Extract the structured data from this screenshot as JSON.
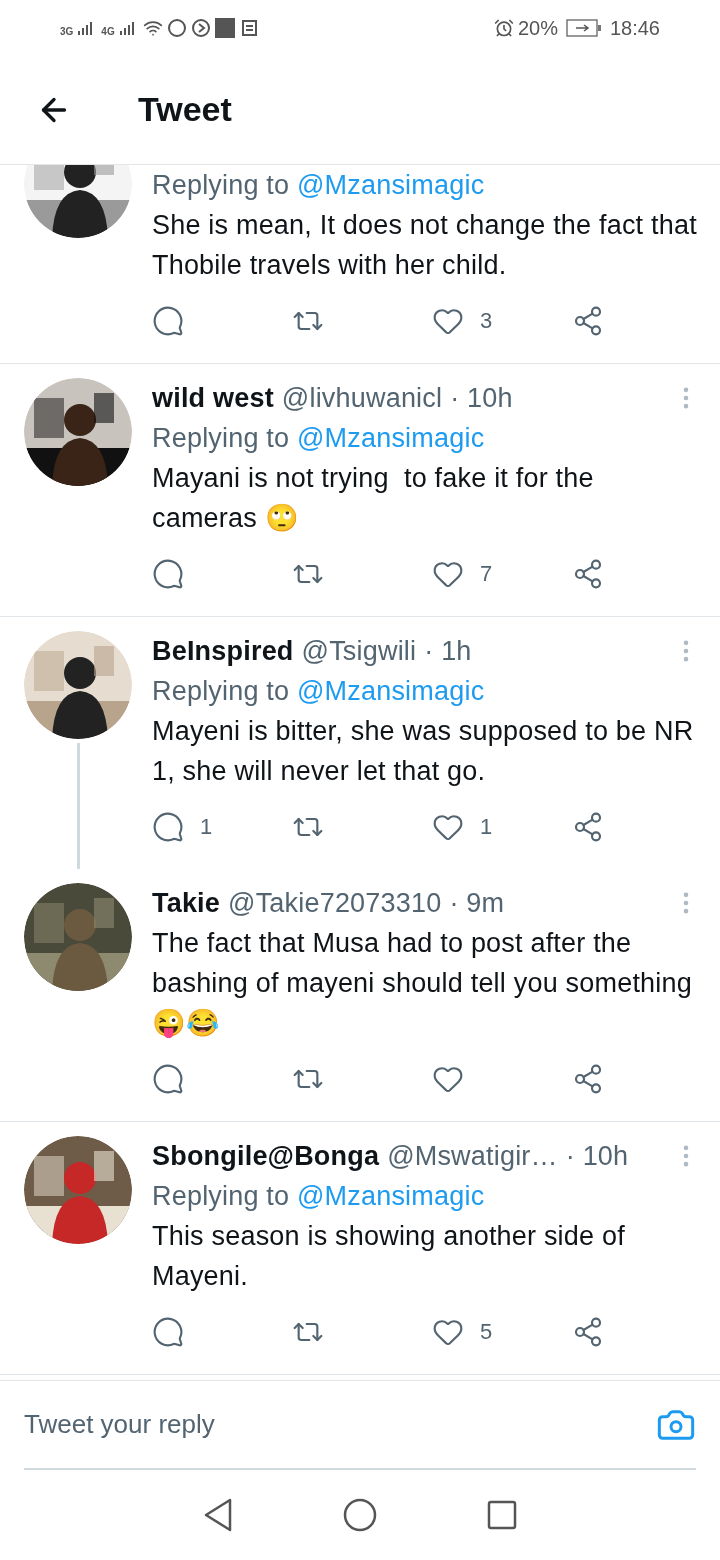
{
  "status_bar": {
    "network_1": "3G",
    "network_2": "4G",
    "battery": "20%",
    "time": "18:46"
  },
  "header": {
    "title": "Tweet"
  },
  "tweets": [
    {
      "replying_prefix": "Replying to",
      "replying_to": "@Mzansimagic",
      "text": "She is mean, It does not change the fact that Thobile travels with her child.",
      "likes": "3",
      "thread_continues": false
    },
    {
      "name": "wild west",
      "handle": "@livhuwanicl",
      "time": "· 10h",
      "replying_prefix": "Replying to",
      "replying_to": "@Mzansimagic",
      "text": "Mayani is not trying  to fake it for the cameras 🙄",
      "thread_continues": false,
      "likes": "7"
    },
    {
      "name": "BeInspired",
      "handle": "@Tsigwili",
      "time": "· 1h",
      "replying_prefix": "Replying to",
      "replying_to": "@Mzansimagic",
      "text": "Mayeni is bitter, she was supposed to be NR 1, she will never let that go.",
      "replies": "1",
      "likes": "1",
      "thread_continues": true
    },
    {
      "name": "Takie",
      "handle": "@Takie72073310",
      "time": "· 9m",
      "text": "The fact that Musa had to post after the bashing of mayeni should tell you something 😜😂",
      "thread_continues": false
    },
    {
      "name": "Sbongile@Bonga",
      "handle": "@Mswatigir…",
      "time": "· 10h",
      "replying_prefix": "Replying to",
      "replying_to": "@Mzansimagic",
      "text": "This season is showing another side of Mayeni.",
      "likes": "5",
      "thread_continues": false
    }
  ],
  "reply_bar": {
    "placeholder": "Tweet your reply"
  }
}
